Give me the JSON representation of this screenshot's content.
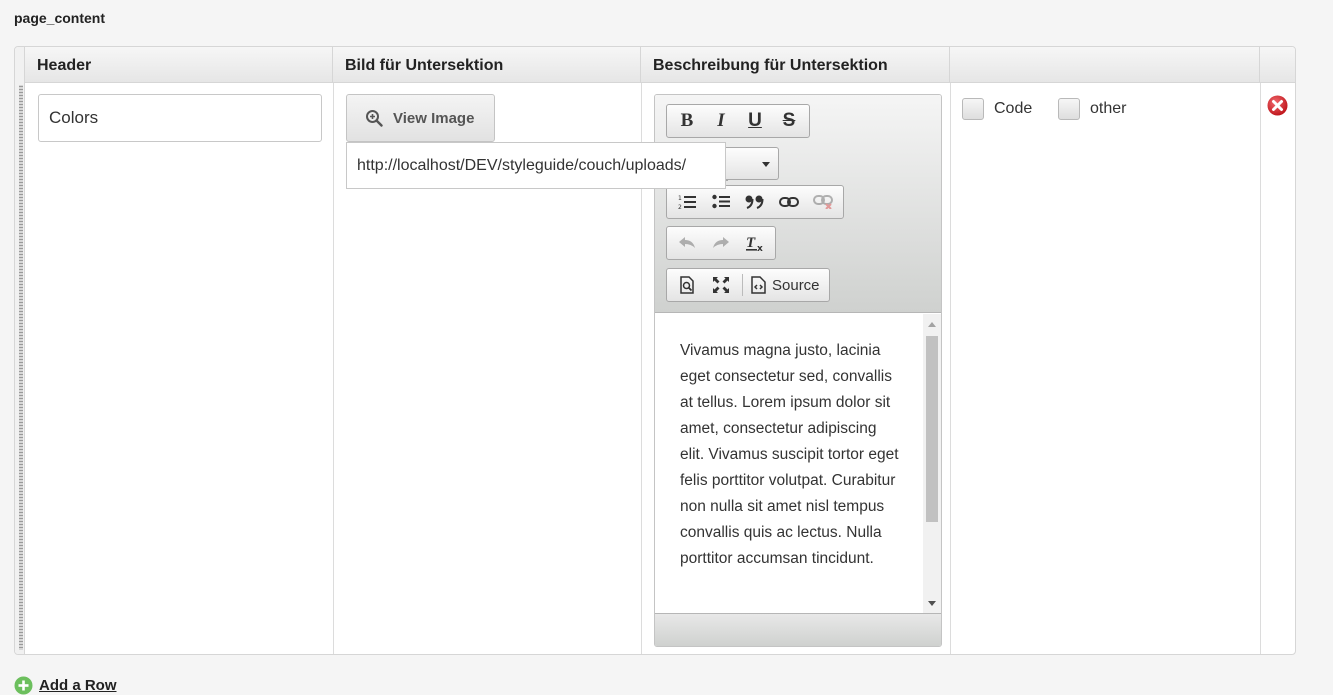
{
  "field": {
    "label": "page_content"
  },
  "table": {
    "headers": [
      "Header",
      "Bild für Untersektion",
      "Beschreibung für Untersektion",
      ""
    ],
    "row": {
      "header_value": "Colors",
      "view_image_label": "View Image",
      "image_url": "http://localhost/DEV/styleguide/couch/uploads/",
      "editor": {
        "source_label": "Source",
        "content": "Vivamus magna justo, lacinia eget consectetur sed, convallis at tellus. Lorem ipsum dolor sit amet, consectetur adipiscing elit. Vivamus suscipit tortor eget felis porttitor volutpat. Curabitur non nulla sit amet nisl tempus convallis quis ac lectus. Nulla porttitor accumsan tincidunt."
      },
      "checkboxes": [
        {
          "label": "Code",
          "checked": false
        },
        {
          "label": "other",
          "checked": false
        }
      ]
    }
  },
  "add_row": {
    "label": "Add a Row"
  },
  "icons": {
    "view_image": "zoom-in-icon",
    "delete": "delete-row-icon",
    "add": "add-row-icon"
  },
  "colors": {
    "delete": "#d8232a",
    "add": "#6cbf5d",
    "header_bg": "#e9e9e9"
  }
}
